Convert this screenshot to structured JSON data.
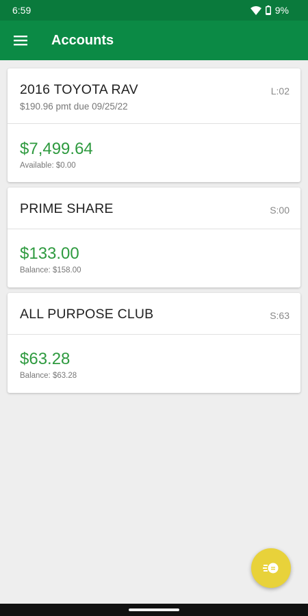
{
  "status_bar": {
    "time": "6:59",
    "battery": "9%"
  },
  "app_bar": {
    "title": "Accounts",
    "menu_icon": "hamburger-menu-icon"
  },
  "accounts": [
    {
      "name": "2016 TOYOTA RAV",
      "subtitle": "$190.96 pmt due 09/25/22",
      "code": "L:02",
      "amount": "$7,499.64",
      "detail": "Available: $0.00"
    },
    {
      "name": "PRIME SHARE",
      "code": "S:00",
      "amount": "$133.00",
      "detail": "Balance: $158.00"
    },
    {
      "name": "ALL PURPOSE CLUB",
      "code": "S:63",
      "amount": "$63.28",
      "detail": "Balance: $63.28"
    }
  ],
  "fab": {
    "icon": "transfer-money-icon"
  },
  "colors": {
    "status_bar": "#0a7a3c",
    "app_bar": "#0b8a45",
    "amount": "#2e9a3f",
    "fab": "#e8d23a",
    "background": "#eeeeee"
  }
}
